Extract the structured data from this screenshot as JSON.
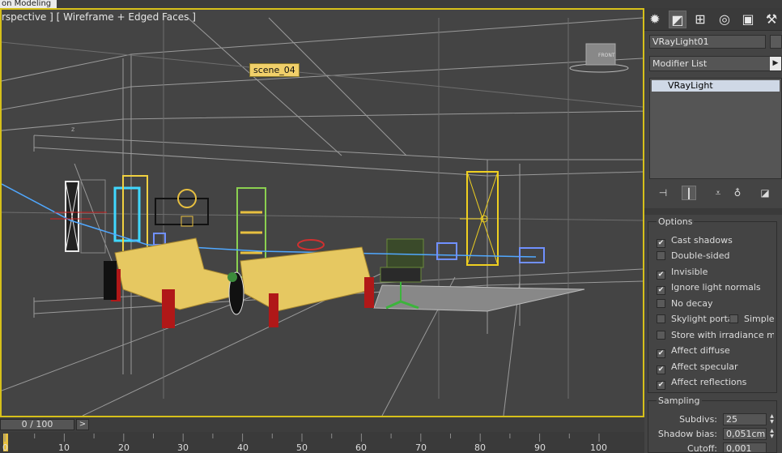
{
  "window": {
    "tab_title": "on Modeling"
  },
  "viewport": {
    "label": "rspective ] [ Wireframe + Edged Faces ]",
    "scene_tag": "scene_04",
    "border_color": "#d6c01a",
    "background_color": "#444444",
    "viewcube_label": "FRONT"
  },
  "time_slider": {
    "label": "0 / 100",
    "next_icon": ">"
  },
  "track_bar": {
    "ticks": [
      "0",
      "10",
      "20",
      "30",
      "40",
      "50",
      "60",
      "70",
      "80",
      "90",
      "100"
    ]
  },
  "command_panel": {
    "tabs": [
      {
        "icon": "sun-icon",
        "glyph": "✹"
      },
      {
        "icon": "modify-icon",
        "glyph": "◩"
      },
      {
        "icon": "hierarchy-icon",
        "glyph": "⊞"
      },
      {
        "icon": "motion-icon",
        "glyph": "◎"
      },
      {
        "icon": "display-icon",
        "glyph": "▣"
      },
      {
        "icon": "utilities-icon",
        "glyph": "⚒"
      }
    ],
    "object_name": "VRayLight01",
    "modifier_list": {
      "selected": "Modifier List",
      "arrow": "▶"
    },
    "stack": {
      "item": "VRayLight"
    },
    "stack_tools": [
      {
        "icon": "pin-stack-icon",
        "glyph": "⊣"
      },
      {
        "icon": "show-end-result-icon",
        "glyph": "┃"
      },
      {
        "icon": "make-unique-icon",
        "glyph": "⩡"
      },
      {
        "icon": "remove-modifier-icon",
        "glyph": "♁"
      },
      {
        "icon": "configure-sets-icon",
        "glyph": "◪"
      }
    ],
    "options": {
      "title": "Options",
      "items": [
        {
          "label": "Cast shadows",
          "checked": true
        },
        {
          "label": "Double-sided",
          "checked": false
        },
        {
          "label": "Invisible",
          "checked": true
        },
        {
          "label": "Ignore light normals",
          "checked": true
        },
        {
          "label": "No decay",
          "checked": false
        },
        {
          "label": "Skylight portal",
          "checked": false
        },
        {
          "label": "Store with irradiance map",
          "checked": false
        },
        {
          "label": "Affect diffuse",
          "checked": true
        },
        {
          "label": "Affect specular",
          "checked": true
        },
        {
          "label": "Affect reflections",
          "checked": true
        }
      ],
      "simple": {
        "label": "Simple",
        "checked": false
      }
    },
    "sampling": {
      "title": "Sampling",
      "subdivs_label": "Subdivs:",
      "subdivs_value": "25",
      "shadow_bias_label": "Shadow bias:",
      "shadow_bias_value": "0,051cm",
      "cutoff_label": "Cutoff:",
      "cutoff_value": "0,001"
    }
  }
}
